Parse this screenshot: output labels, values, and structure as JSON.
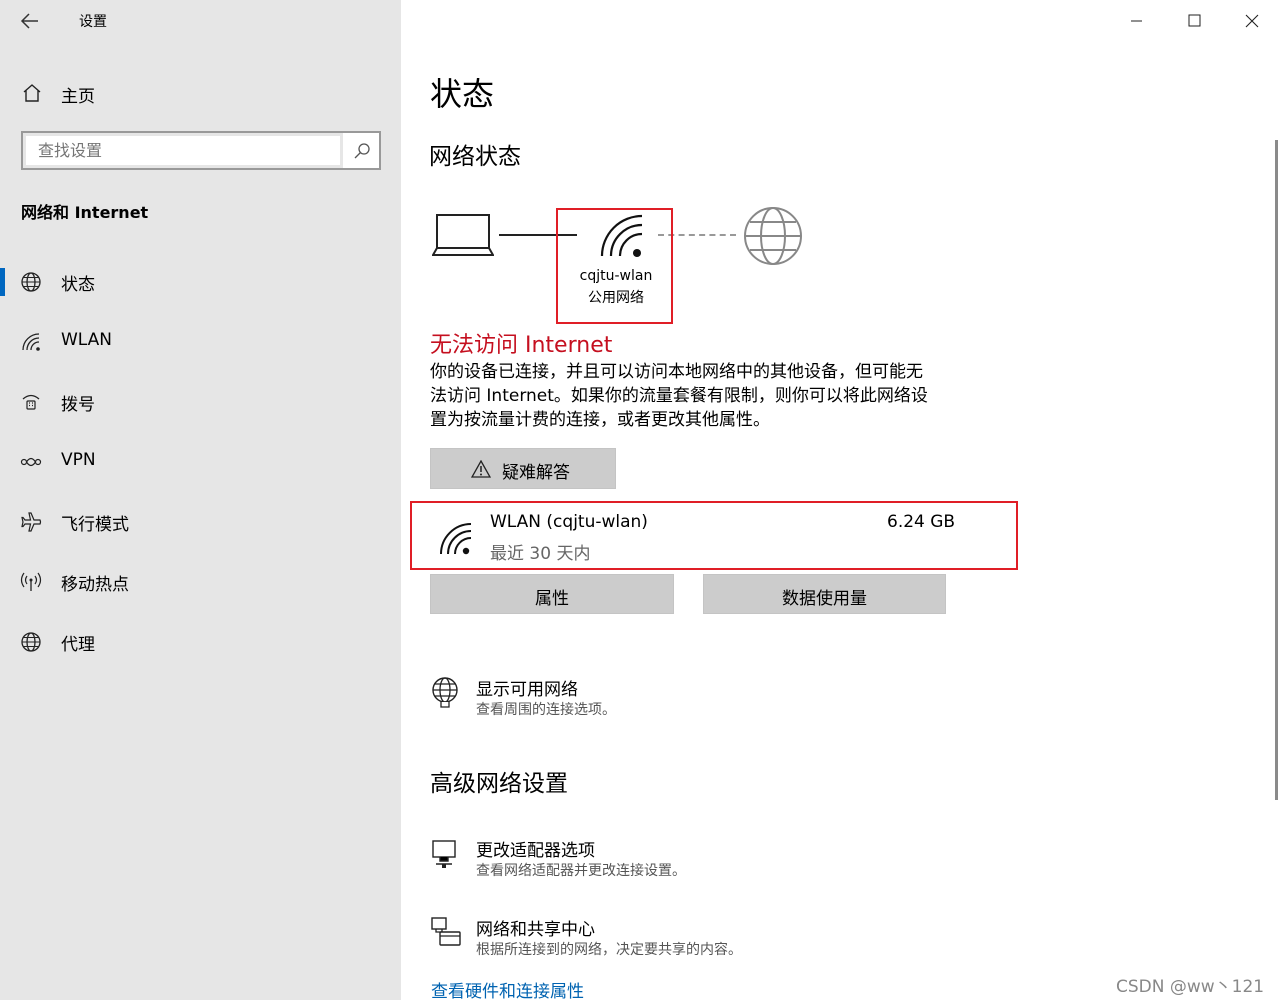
{
  "window": {
    "title": "设置"
  },
  "sidebar": {
    "home_label": "主页",
    "search_placeholder": "查找设置",
    "section_title": "网络和 Internet",
    "items": [
      {
        "label": "状态",
        "icon": "globe-icon",
        "selected": true
      },
      {
        "label": "WLAN",
        "icon": "wifi-icon"
      },
      {
        "label": "拨号",
        "icon": "dialup-icon"
      },
      {
        "label": "VPN",
        "icon": "vpn-icon"
      },
      {
        "label": "飞行模式",
        "icon": "airplane-icon"
      },
      {
        "label": "移动热点",
        "icon": "hotspot-icon"
      },
      {
        "label": "代理",
        "icon": "globe-icon"
      }
    ]
  },
  "main": {
    "page_title": "状态",
    "network_status_title": "网络状态",
    "network_name": "cqjtu-wlan",
    "network_type": "公用网络",
    "status_heading": "无法访问 Internet",
    "status_desc_lines": [
      "你的设备已连接，并且可以访问本地网络中的其他设备，但可能无",
      "法访问 Internet。如果你的流量套餐有限制，则你可以将此网络设",
      "置为按流量计费的连接，或者更改其他属性。"
    ],
    "troubleshoot_label": "疑难解答",
    "connection": {
      "name": "WLAN (cqjtu-wlan)",
      "period": "最近 30 天内",
      "usage": "6.24 GB"
    },
    "properties_label": "属性",
    "data_usage_label": "数据使用量",
    "show_networks": {
      "title": "显示可用网络",
      "subtitle": "查看周围的连接选项。"
    },
    "advanced_title": "高级网络设置",
    "change_adapter": {
      "title": "更改适配器选项",
      "subtitle": "查看网络适配器并更改连接设置。"
    },
    "sharing_center": {
      "title": "网络和共享中心",
      "subtitle": "根据所连接到的网络，决定要共享的内容。"
    },
    "hardware_link": "查看硬件和连接属性"
  },
  "watermark": "CSDN @ww丶121",
  "colors": {
    "accent": "#0067c0",
    "error": "#c50f1f",
    "highlight_box": "#e01e26",
    "link": "#0063b1"
  }
}
